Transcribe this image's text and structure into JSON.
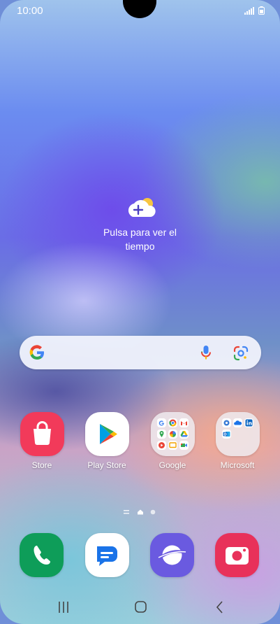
{
  "status_bar": {
    "time": "10:00"
  },
  "weather_widget": {
    "text": "Pulsa para ver el tiempo"
  },
  "search_bar": {
    "provider": "Google"
  },
  "apps": [
    {
      "label": "Store",
      "icon": "galaxy-store-icon",
      "color": "#f23a5a"
    },
    {
      "label": "Play Store",
      "icon": "play-store-icon",
      "color": "#ffffff"
    },
    {
      "label": "Google",
      "icon": "google-folder-icon",
      "color": "#eeebf0"
    },
    {
      "label": "Microsoft",
      "icon": "microsoft-folder-icon",
      "color": "#eeebf0"
    }
  ],
  "dock": [
    {
      "icon": "phone-icon",
      "color": "#0e9d59"
    },
    {
      "icon": "messages-icon",
      "color": "#ffffff"
    },
    {
      "icon": "internet-icon",
      "color": "#6a5ae0"
    },
    {
      "icon": "camera-icon",
      "color": "#e8315a"
    }
  ],
  "page_indicator": {
    "pages": 2,
    "current": 1
  },
  "navigation": [
    "recent-apps",
    "home",
    "back"
  ]
}
